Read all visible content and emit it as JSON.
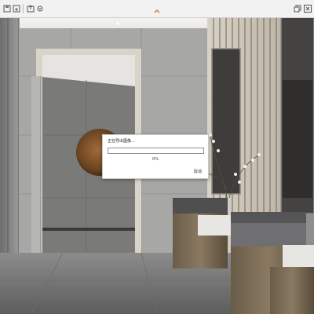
{
  "toolbar": {
    "icons": [
      "save-icon",
      "save-as-icon",
      "export-icon",
      "settings-icon",
      "collapse-icon",
      "restore-window-icon",
      "close-window-icon"
    ]
  },
  "progress_dialog": {
    "title": "正在导出图像...",
    "progress_fraction": 0.0,
    "percent_text": "0%",
    "cancel_label": "取消",
    "accent_color": "#4a90d9"
  }
}
